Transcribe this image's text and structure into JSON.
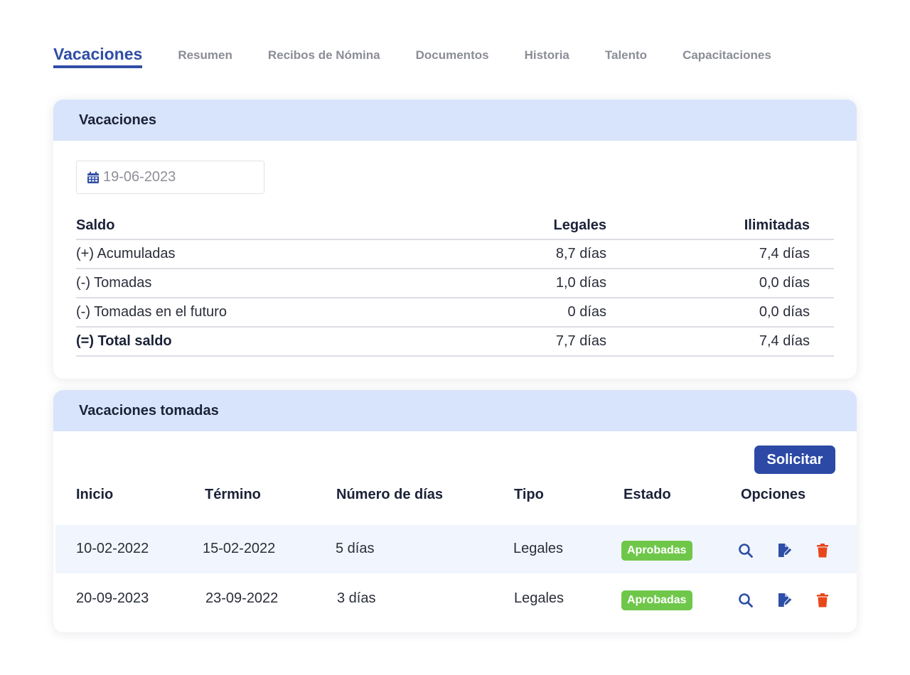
{
  "tabs": [
    {
      "label": "Vacaciones",
      "active": true
    },
    {
      "label": "Resumen",
      "active": false
    },
    {
      "label": "Recibos de Nómina",
      "active": false
    },
    {
      "label": "Documentos",
      "active": false
    },
    {
      "label": "Historia",
      "active": false
    },
    {
      "label": "Talento",
      "active": false
    },
    {
      "label": "Capacitaciones",
      "active": false
    }
  ],
  "vacaciones_card": {
    "title": "Vacaciones",
    "date_value": "19-06-2023",
    "balance": {
      "headers": [
        "Saldo",
        "Legales",
        "Ilimitadas"
      ],
      "rows": [
        [
          "(+) Acumuladas",
          "8,7 días",
          "7,4 días"
        ],
        [
          "(-) Tomadas",
          "1,0 días",
          "0,0 días"
        ],
        [
          "(-) Tomadas en el futuro",
          "0 días",
          "0,0 días"
        ],
        [
          "(=) Total saldo",
          "7,7 días",
          "7,4 días"
        ]
      ]
    }
  },
  "taken_card": {
    "title": "Vacaciones tomadas",
    "request_button": "Solicitar",
    "headers": [
      "Inicio",
      "Término",
      "Número de días",
      "Tipo",
      "Estado",
      "Opciones"
    ],
    "rows": [
      {
        "inicio": "10-02-2022",
        "termino": "15-02-2022",
        "dias": "5 días",
        "tipo": "Legales",
        "estado": "Aprobadas"
      },
      {
        "inicio": "20-09-2023",
        "termino": "23-09-2022",
        "dias": "3 días",
        "tipo": "Legales",
        "estado": "Aprobadas"
      }
    ]
  },
  "colors": {
    "accent": "#2f4ea5",
    "header_bg": "#d8e4fb",
    "approved": "#6fc74a",
    "delete": "#e8471c"
  },
  "icons": {
    "date": "calendar-icon",
    "view": "search-icon",
    "edit": "edit-document-icon",
    "delete": "trash-icon"
  }
}
